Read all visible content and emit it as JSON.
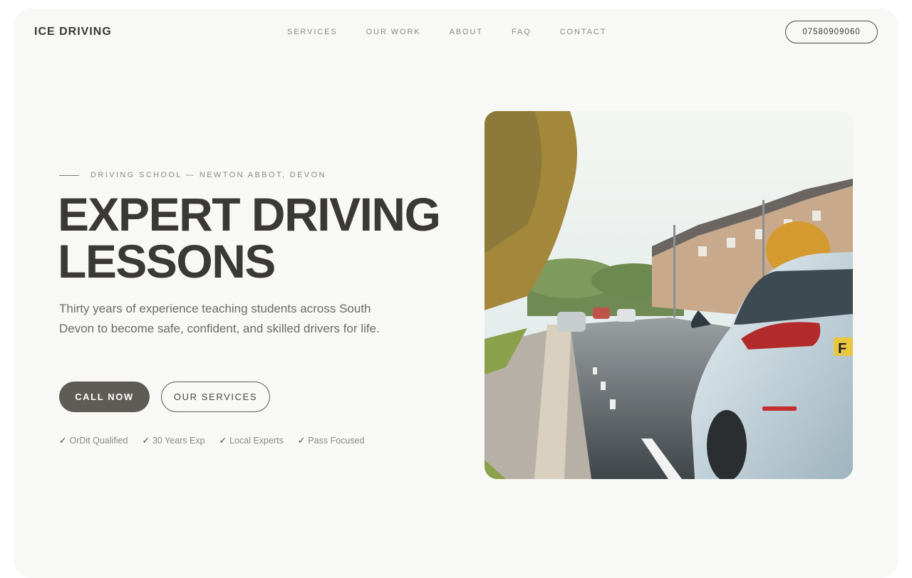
{
  "brand": {
    "logo": "ICE DRIVING"
  },
  "nav": {
    "items": [
      {
        "label": "SERVICES"
      },
      {
        "label": "OUR WORK"
      },
      {
        "label": "ABOUT"
      },
      {
        "label": "FAQ"
      },
      {
        "label": "CONTACT"
      }
    ],
    "phone": "07580909060"
  },
  "hero": {
    "eyebrow": "DRIVING SCHOOL — NEWTON ABBOT, DEVON",
    "headline_line1": "EXPERT DRIVING",
    "headline_line2": "LESSONS",
    "lede": "Thirty years of experience teaching students across South Devon to become safe, confident, and skilled drivers for life.",
    "primary_cta": "CALL NOW",
    "secondary_cta": "OUR SERVICES",
    "features": [
      {
        "check": "✓",
        "label": "OrDit Qualified"
      },
      {
        "check": "✓",
        "label": "30 Years Exp"
      },
      {
        "check": "✓",
        "label": "Local Experts"
      },
      {
        "check": "✓",
        "label": "Pass Focused"
      }
    ],
    "image": {
      "plate_text": "F"
    }
  },
  "colors": {
    "page": "#f8f8f6",
    "text_dark": "#3a3935",
    "text_muted": "#8a8984",
    "button_fill": "#5f5c56"
  }
}
